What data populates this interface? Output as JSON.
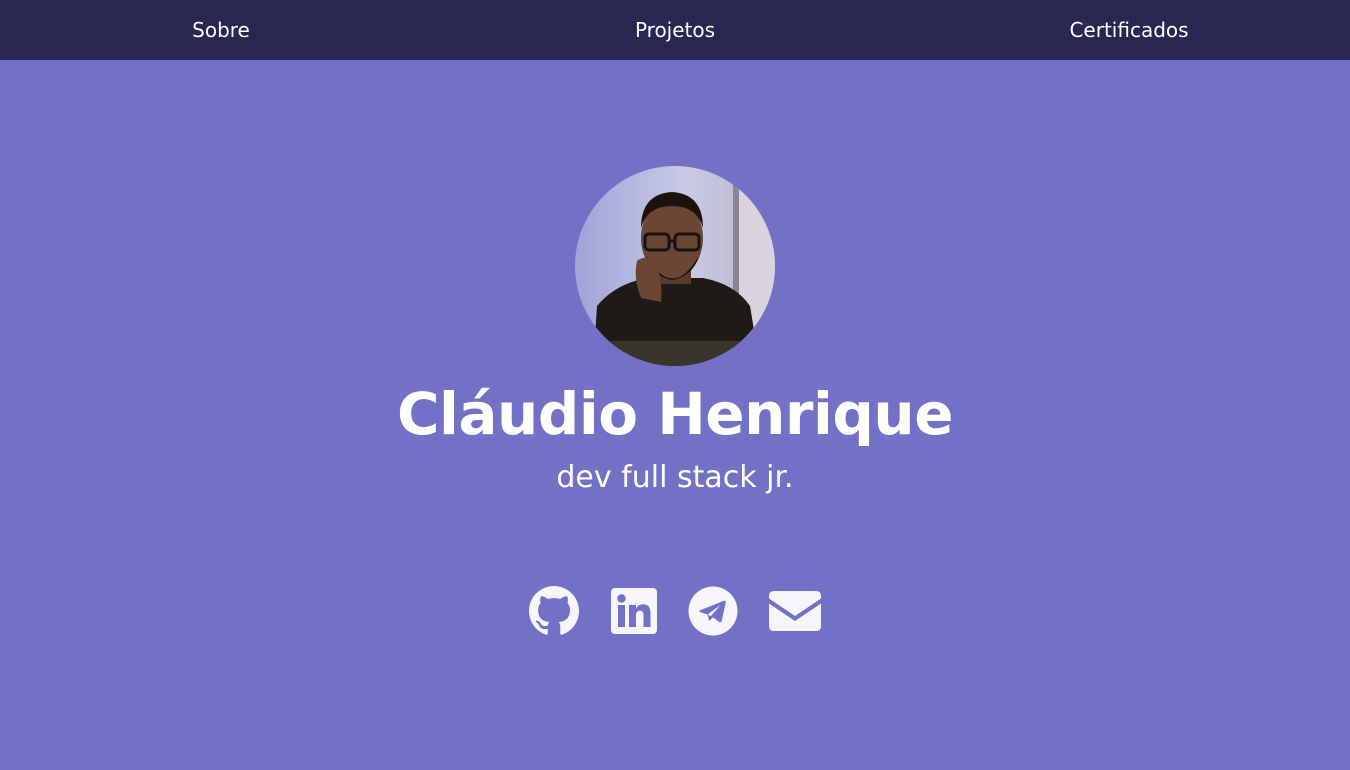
{
  "nav": {
    "items": [
      {
        "label": "Sobre"
      },
      {
        "label": "Projetos"
      },
      {
        "label": "Certificados"
      }
    ]
  },
  "profile": {
    "name": "Cláudio Henrique",
    "role": "dev full stack jr."
  },
  "social": {
    "icons": [
      "github-icon",
      "linkedin-icon",
      "telegram-icon",
      "email-icon"
    ]
  },
  "colors": {
    "nav_background": "#272752",
    "page_background": "#7271c6",
    "text": "#ffffff",
    "icon": "#f5f5fa"
  }
}
